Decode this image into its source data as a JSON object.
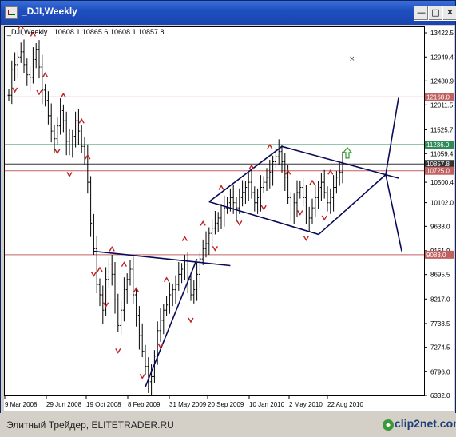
{
  "window": {
    "title": "_DJI,Weekly",
    "minimize_icon": "minimize-icon",
    "maximize_icon": "maximize-icon",
    "close_icon": "close-icon"
  },
  "chart": {
    "symbol_label": "_DJI,Weekly",
    "ohlc": "10608.1 10865.6 10608.1 10857.8",
    "price_ticks": [
      "13422.5",
      "12949.4",
      "12480.9",
      "12011.5",
      "11525.7",
      "11059.4",
      "10500.4",
      "10102.0",
      "9638.0",
      "9161.9",
      "8695.5",
      "8217.0",
      "7738.5",
      "7274.5",
      "6796.0",
      "6332.0"
    ],
    "date_ticks": [
      "9 Mar 2008",
      "29 Jun 2008",
      "19 Oct 2008",
      "8 Feb 2009",
      "31 May 2009",
      "20 Sep 2009",
      "10 Jan 2010",
      "2 May 2010",
      "22 Aug 2010"
    ],
    "level_lines": [
      {
        "label": "12168.0",
        "color": "#c06060",
        "price": 12168.0
      },
      {
        "label": "11236.0",
        "color": "#2e8b57",
        "price": 11236.0
      },
      {
        "label": "10857.8",
        "color": "#333333",
        "price": 10857.8
      },
      {
        "label": "10725.0",
        "color": "#c06060",
        "price": 10725.0
      },
      {
        "label": "9083.0",
        "color": "#c06060",
        "price": 9083.0
      }
    ],
    "up_arrow_icon": "green-up-arrow-icon"
  },
  "footer": {
    "caption": "Элитный Трейдер, ELITETRADER.RU",
    "logo_text": "clip2net.com"
  },
  "chart_data": {
    "type": "candlestick",
    "title": "_DJI,Weekly",
    "price_range": [
      6332.0,
      13422.5
    ],
    "date_range": [
      "9 Mar 2008",
      "22 Aug 2010"
    ],
    "last_bar": {
      "open": 10608.1,
      "high": 10865.6,
      "low": 10608.1,
      "close": 10857.8
    },
    "horizontal_levels": [
      12168.0,
      11236.0,
      10857.8,
      10725.0,
      9083.0
    ],
    "grid": true
  }
}
